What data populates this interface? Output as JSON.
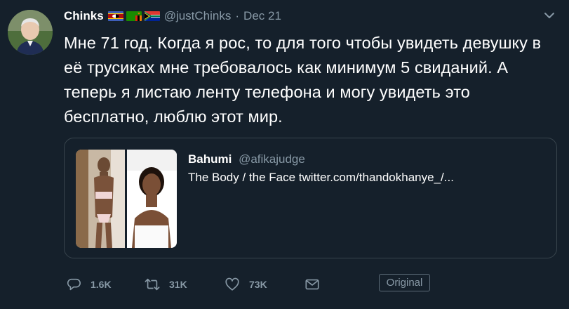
{
  "author": {
    "name": "Chinks",
    "handle": "@justChinks",
    "separator": "·",
    "date": "Dec 21",
    "avatar_icon": "avatar-icon",
    "flags": [
      "swaziland-flag",
      "zambia-flag",
      "south-africa-flag"
    ]
  },
  "tweet": {
    "text": "Мне 71 год. Когда я рос, то для того чтобы увидеть девушку в её трусиках мне требовалось как минимум 5 свиданий. А теперь я листаю ленту телефона и могу увидеть это бесплатно, люблю этот мир."
  },
  "quote": {
    "name": "Bahumi",
    "handle": "@afikajudge",
    "text": "The Body / the Face twitter.com/thandokhanye_/..."
  },
  "actions": {
    "reply_count": "1.6K",
    "retweet_count": "31K",
    "like_count": "73K",
    "original_label": "Original"
  },
  "colors": {
    "background": "#15202b",
    "secondary_text": "#8899a6",
    "border": "#38444d"
  }
}
